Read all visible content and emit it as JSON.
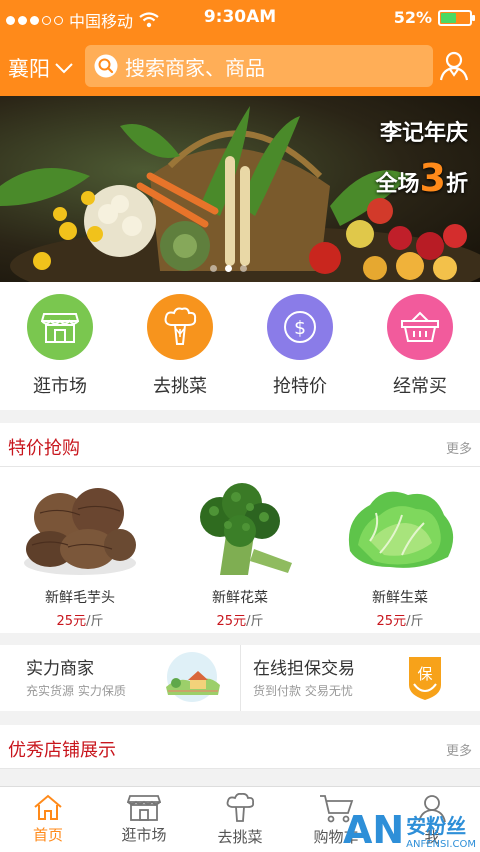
{
  "status_bar": {
    "carrier": "中国移动",
    "time": "9:30AM",
    "battery": "52%",
    "battery_level": 0.52
  },
  "header": {
    "city": "襄阳",
    "search_placeholder": "搜索商家、商品"
  },
  "banner": {
    "line1": "李记年庆",
    "line2_prefix": "全场",
    "line2_number": "3",
    "line2_suffix": "折",
    "pages": 3,
    "active_page": 1
  },
  "categories": [
    {
      "label": "逛市场",
      "icon": "market-stall-icon",
      "color": "#7ac74f"
    },
    {
      "label": "去挑菜",
      "icon": "broccoli-icon",
      "color": "#f7941d"
    },
    {
      "label": "抢特价",
      "icon": "dollar-coin-icon",
      "color": "#8a7ce8"
    },
    {
      "label": "经常买",
      "icon": "basket-icon",
      "color": "#f25b9c"
    }
  ],
  "specials": {
    "title": "特价抢购",
    "more": "更多",
    "items": [
      {
        "name": "新鲜毛芋头",
        "price": "25元",
        "unit": "/斤"
      },
      {
        "name": "新鲜花菜",
        "price": "25元",
        "unit": "/斤"
      },
      {
        "name": "新鲜生菜",
        "price": "25元",
        "unit": "/斤"
      }
    ]
  },
  "promos": [
    {
      "title": "实力商家",
      "subtitle": "充实货源 实力保质"
    },
    {
      "title": "在线担保交易",
      "subtitle": "货到付款 交易无忧",
      "badge": "保"
    }
  ],
  "shops": {
    "title": "优秀店铺展示",
    "more": "更多"
  },
  "tabs": [
    {
      "label": "首页",
      "icon": "home-icon",
      "active": true
    },
    {
      "label": "逛市场",
      "icon": "market-stall-icon",
      "active": false
    },
    {
      "label": "去挑菜",
      "icon": "broccoli-icon",
      "active": false
    },
    {
      "label": "购物车",
      "icon": "cart-icon",
      "active": false
    },
    {
      "label": "我",
      "icon": "user-icon",
      "active": false
    }
  ],
  "watermark": {
    "logo": "AN",
    "text": "安粉丝",
    "url": "ANFENSI.COM"
  },
  "colors": {
    "brand": "#ff8a1a",
    "price_red": "#c8161d"
  }
}
